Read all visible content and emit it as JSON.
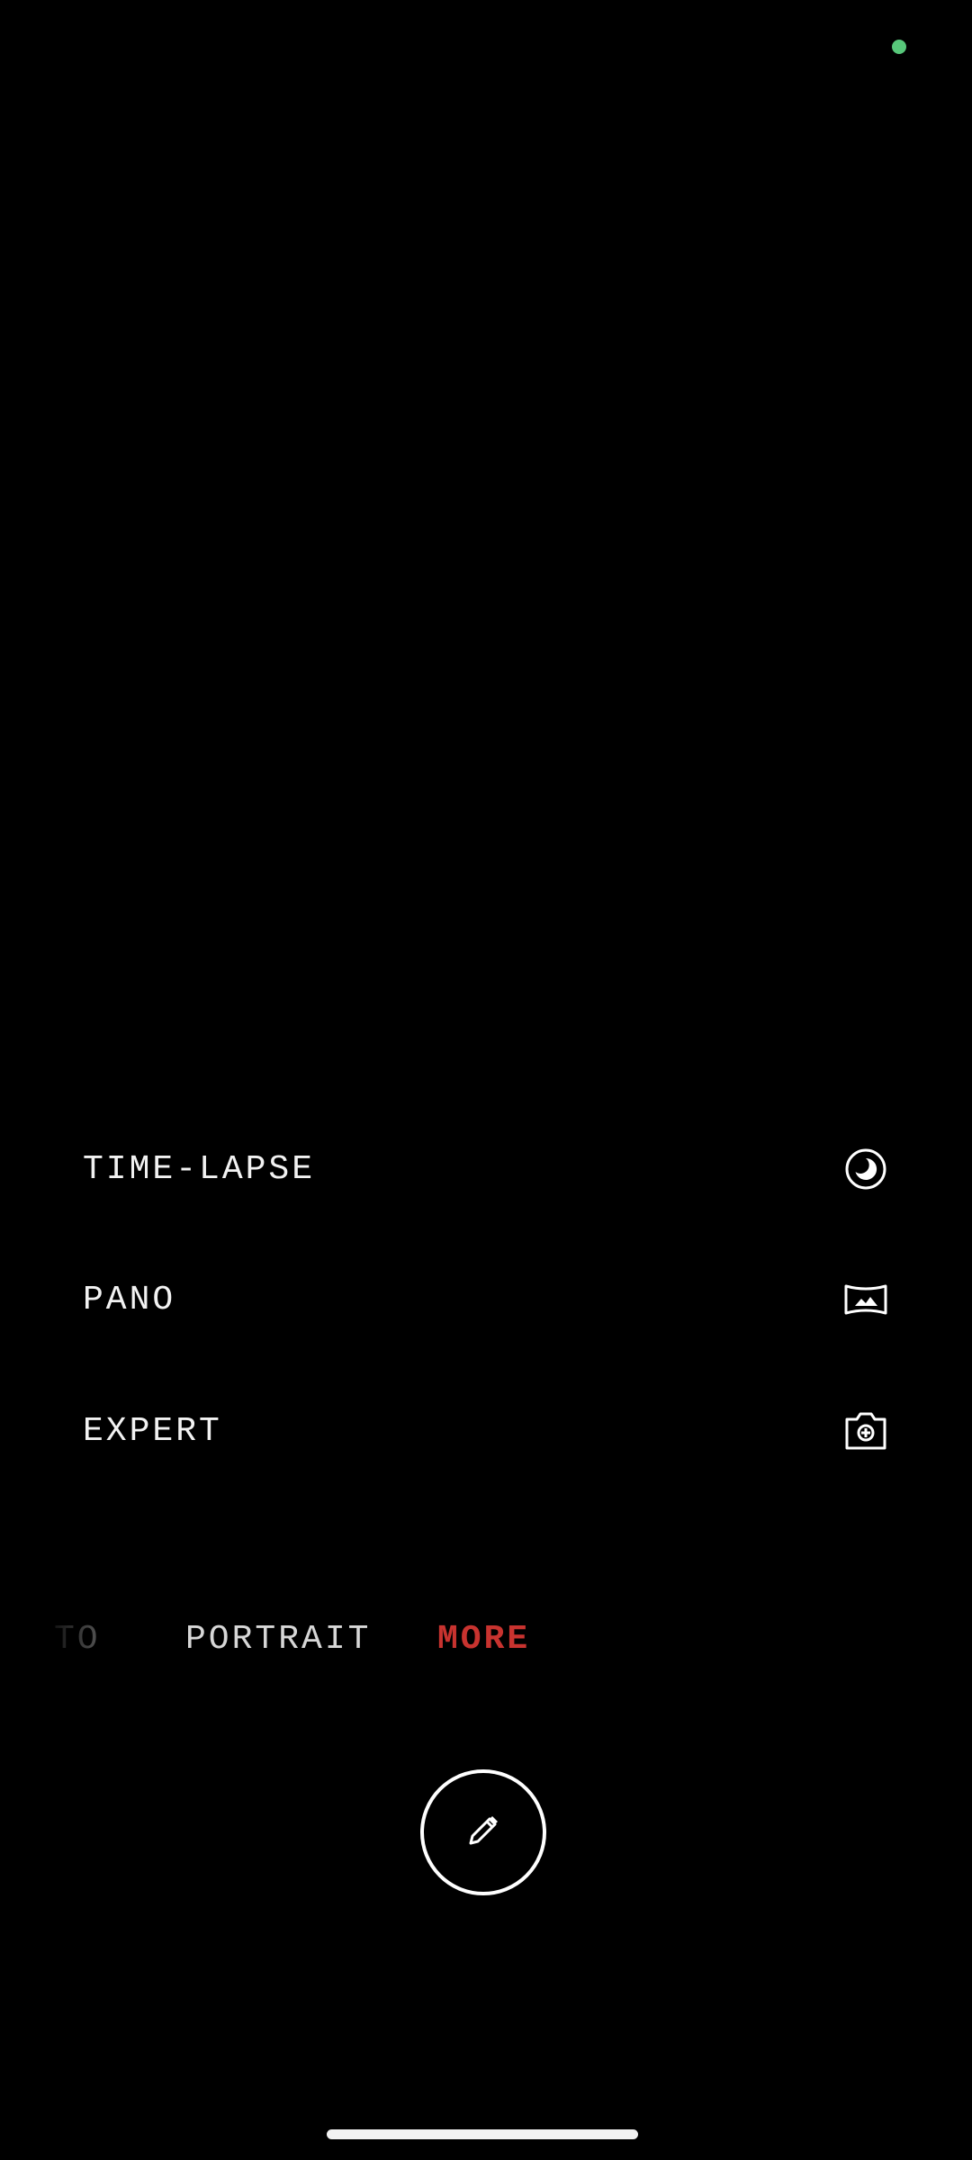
{
  "status": {
    "privacy_dot_color": "#57c77a",
    "privacy_dot_icon": "camera-in-use-dot"
  },
  "modes": [
    {
      "label": "TIME-LAPSE",
      "icon": "timelapse-icon"
    },
    {
      "label": "PANO",
      "icon": "panorama-icon"
    },
    {
      "label": "EXPERT",
      "icon": "expert-camera-icon"
    }
  ],
  "mode_tabs": {
    "photo_partial": "TO",
    "portrait": "PORTRAIT",
    "more": "MORE",
    "selected": "MORE",
    "selected_color": "#c8332f"
  },
  "shutter": {
    "icon": "edit-pencil-icon"
  }
}
